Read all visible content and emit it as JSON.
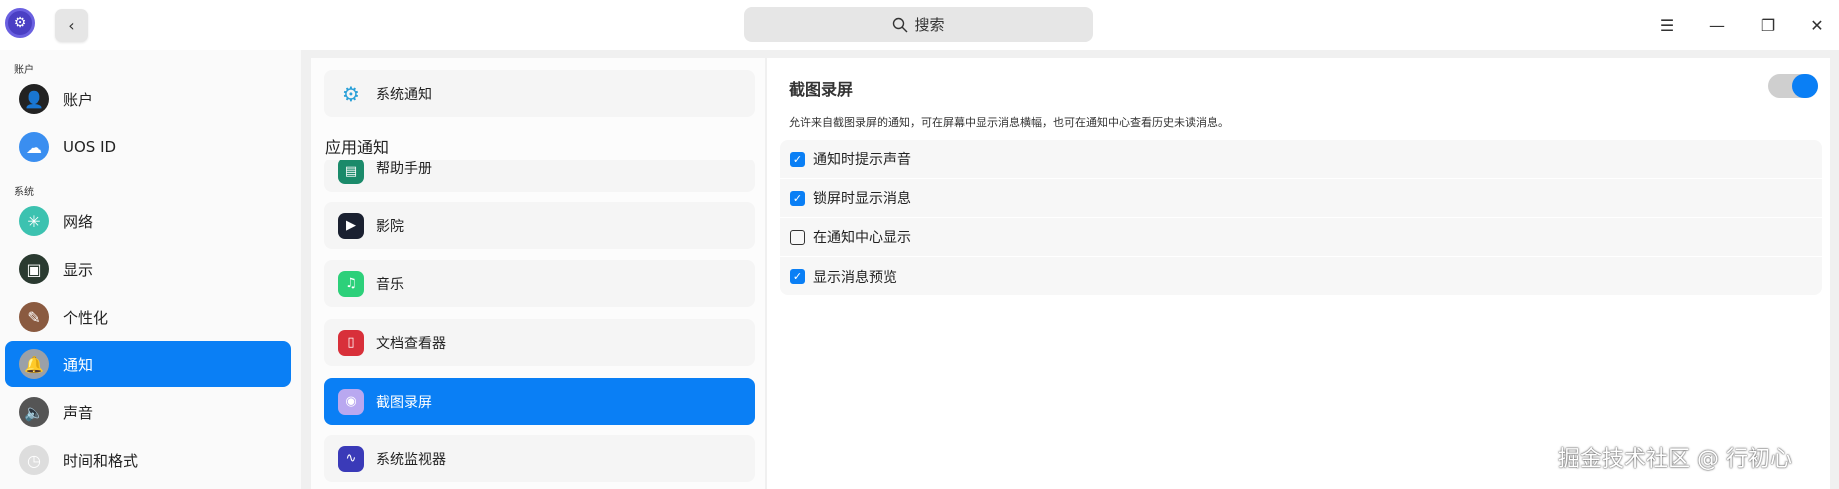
{
  "header": {
    "search_placeholder": "搜索",
    "back_label": "‹",
    "icons": [
      "app-logo-icon",
      "back-icon",
      "search-icon",
      "menu-icon",
      "minimize-icon",
      "maximize-icon",
      "close-icon"
    ]
  },
  "sidebar": {
    "sections": [
      {
        "label": "账户"
      },
      {
        "label": "系统"
      }
    ],
    "items": [
      {
        "label": "账户",
        "icon": "account-icon",
        "color": "#222"
      },
      {
        "label": "UOS ID",
        "icon": "cloud-icon",
        "color": "#3a8ef0"
      },
      {
        "label": "网络",
        "icon": "network-icon",
        "color": "#3cc2b0"
      },
      {
        "label": "显示",
        "icon": "display-icon",
        "color": "#2a3a30"
      },
      {
        "label": "个性化",
        "icon": "palette-icon",
        "color": "#8a5a40"
      },
      {
        "label": "通知",
        "icon": "bell-icon",
        "color": "#9aa0a8",
        "selected": true
      },
      {
        "label": "声音",
        "icon": "speaker-icon",
        "color": "#555"
      },
      {
        "label": "时间和格式",
        "icon": "clock-icon",
        "color": "#ddd"
      }
    ]
  },
  "middle": {
    "system_notification": "系统通知",
    "app_heading": "应用通知",
    "apps": [
      {
        "label": "帮助手册",
        "icon": "manual-icon",
        "color": "#1a8a6a"
      },
      {
        "label": "影院",
        "icon": "movie-icon",
        "color": "#1a2030"
      },
      {
        "label": "音乐",
        "icon": "music-icon",
        "color": "#2dd07a"
      },
      {
        "label": "文档查看器",
        "icon": "document-viewer-icon",
        "color": "#d8303a"
      },
      {
        "label": "截图录屏",
        "icon": "camera-icon",
        "color": "#b9a8f0",
        "selected": true
      },
      {
        "label": "系统监视器",
        "icon": "system-monitor-icon",
        "color": "#3a3ab8"
      }
    ]
  },
  "detail": {
    "title": "截图录屏",
    "enabled": true,
    "description": "允许来自截图录屏的通知，可在屏幕中显示消息横幅，也可在通知中心查看历史未读消息。",
    "options": [
      {
        "label": "通知时提示声音",
        "checked": true
      },
      {
        "label": "锁屏时显示消息",
        "checked": true
      },
      {
        "label": "在通知中心显示",
        "checked": false
      },
      {
        "label": "显示消息预览",
        "checked": true
      }
    ]
  },
  "watermark": "掘金技术社区 @ 行初心",
  "colors": {
    "accent": "#0a7ff5"
  }
}
